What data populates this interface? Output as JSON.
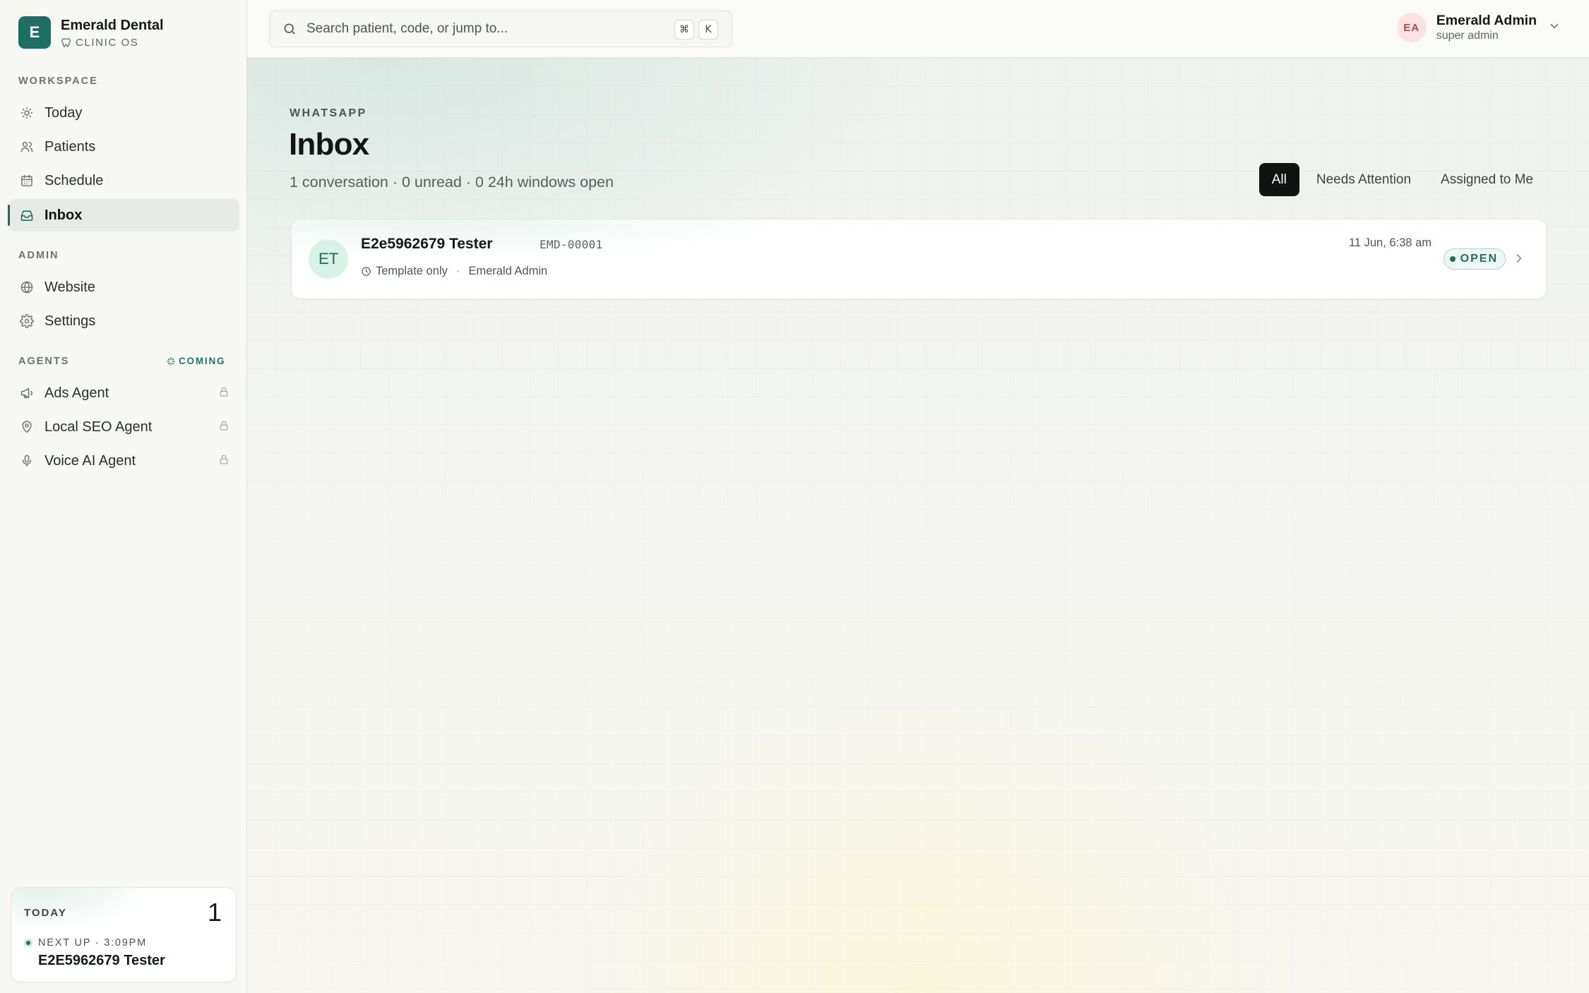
{
  "brand": {
    "initial": "E",
    "name": "Emerald Dental",
    "subtitle": "CLINIC OS"
  },
  "sidebar": {
    "workspace_label": "WORKSPACE",
    "admin_label": "ADMIN",
    "agents_label": "AGENTS",
    "coming_label": "COMING",
    "workspace_items": [
      {
        "label": "Today",
        "icon": "sun-icon"
      },
      {
        "label": "Patients",
        "icon": "users-icon"
      },
      {
        "label": "Schedule",
        "icon": "calendar-icon"
      },
      {
        "label": "Inbox",
        "icon": "inbox-icon",
        "active": true
      }
    ],
    "admin_items": [
      {
        "label": "Website",
        "icon": "globe-icon"
      },
      {
        "label": "Settings",
        "icon": "gear-icon"
      }
    ],
    "agent_items": [
      {
        "label": "Ads Agent",
        "icon": "megaphone-icon",
        "locked": true
      },
      {
        "label": "Local SEO Agent",
        "icon": "map-pin-icon",
        "locked": true
      },
      {
        "label": "Voice AI Agent",
        "icon": "mic-icon",
        "locked": true
      }
    ]
  },
  "today_card": {
    "label": "TODAY",
    "count": "1",
    "next_up": "NEXT UP · 3:09PM",
    "next_name": "E2E5962679 Tester"
  },
  "topbar": {
    "search_placeholder": "Search patient, code, or jump to...",
    "shortcut_mod": "⌘",
    "shortcut_key": "K",
    "user_initials": "EA",
    "user_name": "Emerald Admin",
    "user_role": "super admin"
  },
  "page": {
    "eyebrow": "WHATSAPP",
    "title": "Inbox",
    "summary": "1 conversation · 0 unread · 0 24h windows open"
  },
  "filters": [
    {
      "label": "All",
      "active": true
    },
    {
      "label": "Needs Attention",
      "active": false
    },
    {
      "label": "Assigned to Me",
      "active": false
    }
  ],
  "conversations": [
    {
      "initials": "ET",
      "name": "E2e5962679 Tester",
      "code": "EMD-00001",
      "mode": "Template only",
      "assignee": "Emerald Admin",
      "time": "11 Jun, 6:38 am",
      "status": "OPEN"
    }
  ],
  "colors": {
    "accent": "#1d6f63",
    "active_filter": "#0f1412",
    "open_badge_bg": "#edf8f4"
  }
}
